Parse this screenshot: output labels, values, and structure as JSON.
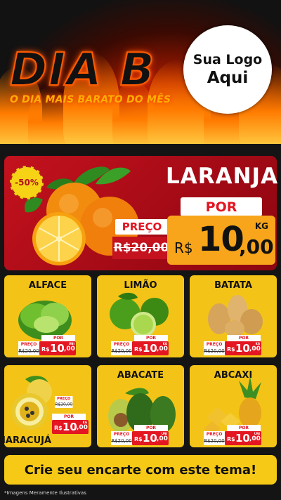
{
  "header": {
    "title": "DIA B",
    "subtitle": "O DIA MAIS BARATO DO MÊS",
    "logo_line1": "Sua Logo",
    "logo_line2": "Aqui"
  },
  "featured": {
    "discount": "-50%",
    "name": "LARANJA",
    "por_label": "POR",
    "preco_label": "PREÇO",
    "old_price": "R$20,00",
    "currency": "R$",
    "price_int": "10",
    "price_dec": ",00",
    "unit": "KG"
  },
  "products": [
    {
      "name": "ALFACE",
      "preco_label": "PREÇO",
      "old_price": "R$20,00",
      "por_label": "POR",
      "currency": "R$",
      "price_int": "10",
      "price_dec": ",00",
      "unit": "UNI"
    },
    {
      "name": "LIMÃO",
      "preco_label": "PREÇO",
      "old_price": "R$20,00",
      "por_label": "POR",
      "currency": "R$",
      "price_int": "10",
      "price_dec": ",00",
      "unit": "KG"
    },
    {
      "name": "BATATA",
      "preco_label": "PREÇO",
      "old_price": "R$20,00",
      "por_label": "POR",
      "currency": "R$",
      "price_int": "10",
      "price_dec": ",00",
      "unit": "KG"
    },
    {
      "name": "MARACUJÁ",
      "preco_label": "PREÇO",
      "old_price": "R$20,00",
      "por_label": "POR",
      "currency": "R$",
      "price_int": "10",
      "price_dec": ",00",
      "unit": "KG"
    },
    {
      "name": "ABACATE",
      "preco_label": "PREÇO",
      "old_price": "R$20,00",
      "por_label": "POR",
      "currency": "R$",
      "price_int": "10",
      "price_dec": ",00",
      "unit": "UNI"
    },
    {
      "name": "ABCAXI",
      "preco_label": "PREÇO",
      "old_price": "R$20,00",
      "por_label": "POR",
      "currency": "R$",
      "price_int": "10",
      "price_dec": ",00",
      "unit": "UNI"
    }
  ],
  "cta": "Crie seu encarte com este tema!",
  "footnote": "*Imagens Meramente Ilustrativas",
  "colors": {
    "red": "#c4121e",
    "yellow": "#f3c417",
    "orange": "#f8a51b",
    "dark": "#141414"
  }
}
